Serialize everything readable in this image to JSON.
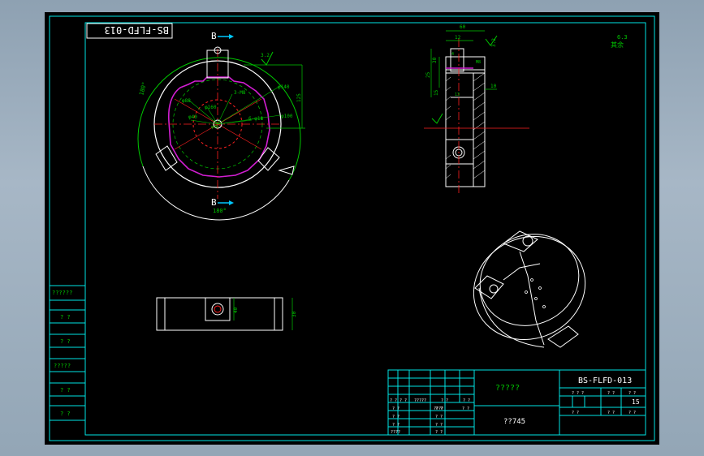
{
  "drawing": {
    "corner_code": "BS-FLFD-013",
    "title_block_code": "BS-FLFD-013",
    "part_name": "?????",
    "material": "??745",
    "scale_or_count": "15",
    "colors": {
      "background": "#000000",
      "frame": "#00e5e5",
      "geometry": "#ffffff",
      "dimension": "#00c800",
      "centerline": "#ff2020",
      "hatch_circle": "#d21ed2",
      "section_arrow": "#00c8ff"
    }
  },
  "section_marks": {
    "top": "B",
    "bottom": "B"
  },
  "angle_labels": {
    "left": "180°",
    "bottom": "180°"
  },
  "dimensions": {
    "main_view": [
      "φ140",
      "φ100",
      "φ88",
      "φ40",
      "3-M8",
      "6-φ18",
      "φ40",
      "φ160",
      "125",
      "3.2"
    ],
    "side_view": [
      "60",
      "12",
      "25",
      "15",
      "30",
      "10",
      "M8",
      "13",
      "3.2",
      "4"
    ],
    "bottom_view": [
      "40",
      "30"
    ],
    "surface_finish": "6.3",
    "surface_note": "其余"
  },
  "left_strip": {
    "cells": [
      "??????",
      "? ?",
      "? ?",
      "?????",
      "? ?",
      "? ?"
    ]
  },
  "title_block": {
    "grid_labels": [
      "? ?",
      "? ?",
      "?????",
      "? ?",
      "? ?",
      "? ?",
      "? ?",
      "????",
      "? ?",
      "? ?",
      "? ?",
      "? ?",
      "? ?",
      "????",
      "? ?"
    ],
    "right_labels": [
      "? ? ?",
      "? ?",
      "? ?",
      "? ?",
      "? ?",
      "? ?"
    ]
  }
}
